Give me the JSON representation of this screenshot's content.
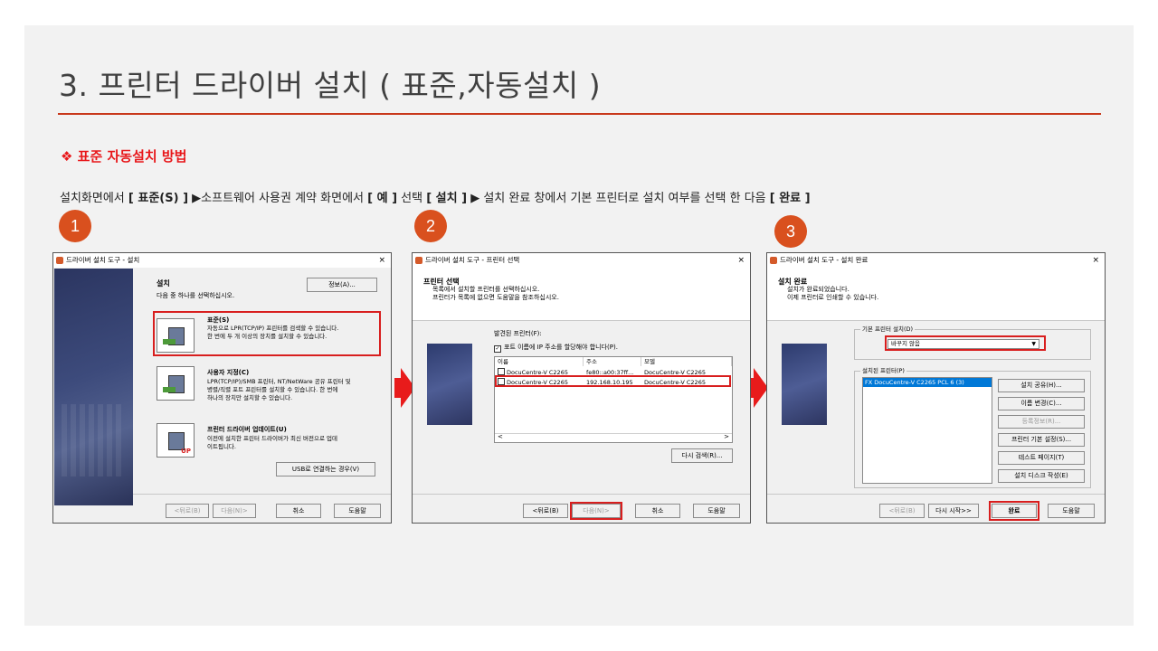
{
  "slide": {
    "title": "3. 프린터 드라이버 설치 ( 표준,자동설치 )",
    "subtitle": "❖ 표준 자동설치 방법",
    "desc_parts": [
      "설치화면에서 ",
      "[ 표준(S) ]",
      " ▶소프트웨어 사용권 계약 화면에서 ",
      "[ 예 ]",
      " 선택  ",
      "[ 설치 ]",
      " ▶ 설치 완료 창에서 기본 프린터로 설치 여부를 선택 한 다음 ",
      "[ 완료 ]"
    ]
  },
  "badges": [
    "1",
    "2",
    "3"
  ],
  "colors": {
    "accent": "#d9501e",
    "rule": "#c8381b",
    "red": "#e81b1b",
    "slide_bg": "#f2f2f2"
  },
  "win1": {
    "title": "드라이버 설치 도구 - 설치",
    "close": "×",
    "heading": "설치",
    "subheading": "다음 중 하나를 선택하십시오.",
    "info_button": "정보(A)...",
    "options": [
      {
        "title": "표준(S)",
        "lines": [
          "자동으로 LPR(TCP/IP) 프린터를 검색할 수 있습니다.",
          "한 번에 두 개  이상의 장치를 설치할 수 있습니다."
        ]
      },
      {
        "title": "사용자 지정(C)",
        "lines": [
          "LPR(TCP/IP)/SMB 프린터, NT/NetWare 공유 프린터 및",
          "병렬/직렬 포트 프린터를 설치할 수 있습니다. 한 번에",
          "하나의 장치만 설치할 수 있습니다."
        ]
      },
      {
        "title": "프린터 드라이버 업데이트(U)",
        "lines": [
          "이전에 설치한 프린터 드라이버가 최신 버전으로 업데",
          "이트됩니다."
        ]
      }
    ],
    "usb_button": "USB로 연결하는 경우(V)",
    "back_button": "<뒤로(B)",
    "next_button": "다음(N)>",
    "cancel_button": "취소",
    "help_button": "도움말",
    "up_badge": "UP"
  },
  "win2": {
    "title": "드라이버 설치 도구 - 프린터 선택",
    "close": "×",
    "heading": "프린터 선택",
    "subheading_lines": [
      "목록에서 설치할 프린터를 선택하십시오.",
      "프린터가 목록에 없으면 도움말을 참조하십시오."
    ],
    "found_label": "발견된 프린터(F):",
    "checkbox_label": "포트 이름에 IP 주소를 할당해야 합니다(P).",
    "checkbox_mark": "✓",
    "columns": [
      "이름",
      "주소",
      "모델"
    ],
    "rows": [
      {
        "name": "DocuCentre-V C2265",
        "addr": "fe80::a00:37ff...",
        "model": "DocuCentre-V C2265"
      },
      {
        "name": "DocuCentre-V C2265",
        "addr": "192.168.10.195",
        "model": "DocuCentre-V C2265"
      }
    ],
    "scroll_left": "<",
    "scroll_right": ">",
    "research_button": "다시 검색(R)...",
    "back_button": "<뒤로(B)",
    "next_button": "다음(N)>",
    "cancel_button": "취소",
    "help_button": "도움말"
  },
  "win3": {
    "title": "드라이버 설치 도구 - 설치 완료",
    "close": "×",
    "heading": "설치 완료",
    "subheading_lines": [
      "설치가 완료되었습니다.",
      "이제 프린터로 인쇄할 수 있습니다."
    ],
    "default_group": "기본 프린터 설치(D)",
    "default_value": "바꾸지 않음",
    "installed_group": "설치된 프린터(P)",
    "installed_item": "FX DocuCentre-V C2265 PCL 6 (3)",
    "side_buttons": [
      "설치 공유(H)...",
      "이름 변경(C)...",
      "등록정보(R)...",
      "프린터 기본 설정(S)...",
      "테스트 페이지(T)",
      "설치 디스크 작성(E)"
    ],
    "back_button": "<뒤로(B)",
    "restart_button": "다시 시작>>",
    "finish_button": "완료",
    "help_button": "도움말"
  }
}
